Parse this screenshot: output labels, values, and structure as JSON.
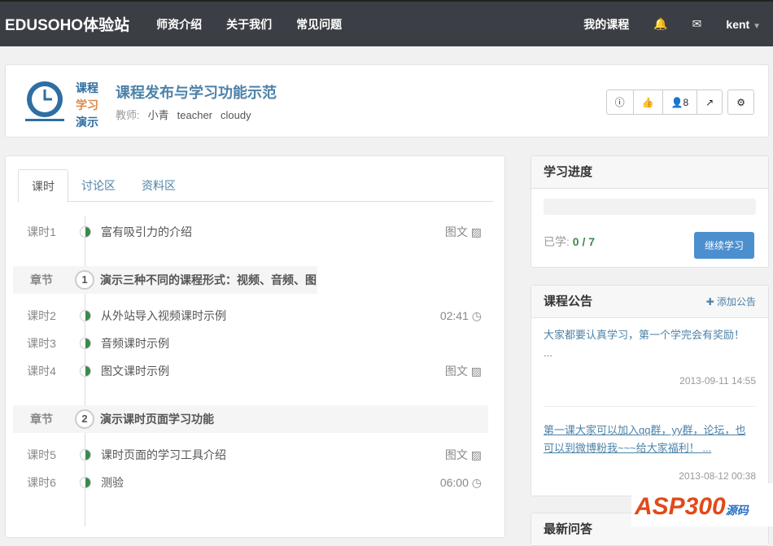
{
  "nav": {
    "brand": "EDUSOHO体验站",
    "links": [
      "师资介绍",
      "关于我们",
      "常见问题"
    ],
    "my_courses": "我的课程",
    "user": "kent"
  },
  "header": {
    "logo_text": [
      "课程",
      "学习",
      "演示"
    ],
    "title": "课程发布与学习功能示范",
    "teacher_label": "教师:",
    "teachers": [
      "小青",
      "teacher",
      "cloudy"
    ],
    "student_count": "8"
  },
  "tabs": [
    "课时",
    "讨论区",
    "资料区"
  ],
  "lessons": [
    {
      "kind": "lesson",
      "key": "课时1",
      "title": "富有吸引力的介绍",
      "right": "图文",
      "icon": "image-icon"
    },
    {
      "kind": "chapter",
      "key": "章节",
      "num": "1",
      "title": "演示三种不同的课程形式：视频、音频、图"
    },
    {
      "kind": "lesson",
      "key": "课时2",
      "title": "从外站导入视频课时示例",
      "right": "02:41",
      "icon": "clock-icon"
    },
    {
      "kind": "lesson",
      "key": "课时3",
      "title": "音频课时示例",
      "right": "",
      "icon": ""
    },
    {
      "kind": "lesson",
      "key": "课时4",
      "title": "图文课时示例",
      "right": "图文",
      "icon": "image-icon"
    },
    {
      "kind": "chapter",
      "key": "章节",
      "num": "2",
      "title": "演示课时页面学习功能"
    },
    {
      "kind": "lesson",
      "key": "课时5",
      "title": "课时页面的学习工具介绍",
      "right": "图文",
      "icon": "image-icon"
    },
    {
      "kind": "lesson",
      "key": "课时6",
      "title": "测验",
      "right": "06:00",
      "icon": "clock-icon"
    }
  ],
  "progress": {
    "title": "学习进度",
    "learned_label": "已学:",
    "learned": "0 / 7",
    "percent": 0,
    "continue": "继续学习"
  },
  "announcements": {
    "title": "课程公告",
    "add": "添加公告",
    "items": [
      {
        "text": "大家都要认真学习，第一个学完会有奖励！ ...",
        "date": "2013-09-11 14:55"
      },
      {
        "text": "第一课大家可以加入qq群，yy群，论坛，也可以到微博粉我~~~给大家福利！ ...",
        "date": "2013-08-12 00:38"
      }
    ]
  },
  "qa": {
    "title": "最新问答"
  },
  "watermark": "ASP300源码 .com"
}
